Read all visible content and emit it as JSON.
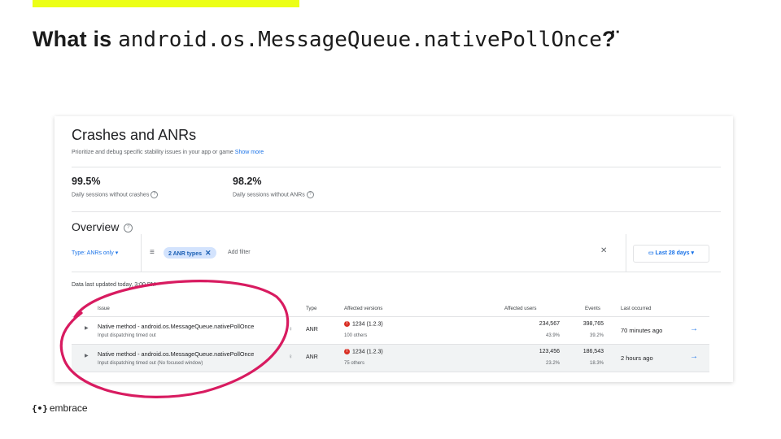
{
  "slide": {
    "title_prefix": "What is ",
    "title_code": "android.os.MessageQueue.nativePollOnce",
    "title_suffix": "?̈",
    "accent_color": "#ecff16",
    "annotation_color": "#d81b60"
  },
  "console": {
    "title": "Crashes and ANRs",
    "subtitle": "Prioritize and debug specific stability issues in your app or game",
    "show_more": "Show more",
    "stats": [
      {
        "value": "99.5%",
        "label": "Daily sessions without crashes"
      },
      {
        "value": "98.2%",
        "label": "Daily sessions without ANRs"
      }
    ],
    "overview_title": "Overview",
    "filter_type": "Type: ANRs only ▾",
    "filter_icon": "≡",
    "chip_label": "2 ANR types",
    "add_filter": "Add filter",
    "clear_icon": "✕",
    "date_range": "Last 28 days",
    "data_updated": "Data last updated today, 3:00 PM",
    "columns": {
      "issue": "Issue",
      "type": "Type",
      "affected_versions": "Affected versions",
      "affected_users": "Affected users",
      "events": "Events",
      "last_occurred": "Last occurred"
    },
    "rows": [
      {
        "title": "Native method - android.os.MessageQueue.nativePollOnce",
        "subtitle": "Input dispatching timed out",
        "type": "ANR",
        "version": "1234 (1.2.3)",
        "version_others": "100 others",
        "users": "234,567",
        "users_pct": "43.9%",
        "events": "398,765",
        "events_pct": "39.2%",
        "last": "70 minutes ago"
      },
      {
        "title": "Native method - android.os.MessageQueue.nativePollOnce",
        "subtitle": "Input dispatching timed out (No focused window)",
        "type": "ANR",
        "version": "1234 (1.2.3)",
        "version_others": "75 others",
        "users": "123,456",
        "users_pct": "23.2%",
        "events": "186,543",
        "events_pct": "18.3%",
        "last": "2 hours ago"
      }
    ]
  },
  "footer": {
    "logo_glyph": "{•}",
    "brand": "embrace"
  }
}
